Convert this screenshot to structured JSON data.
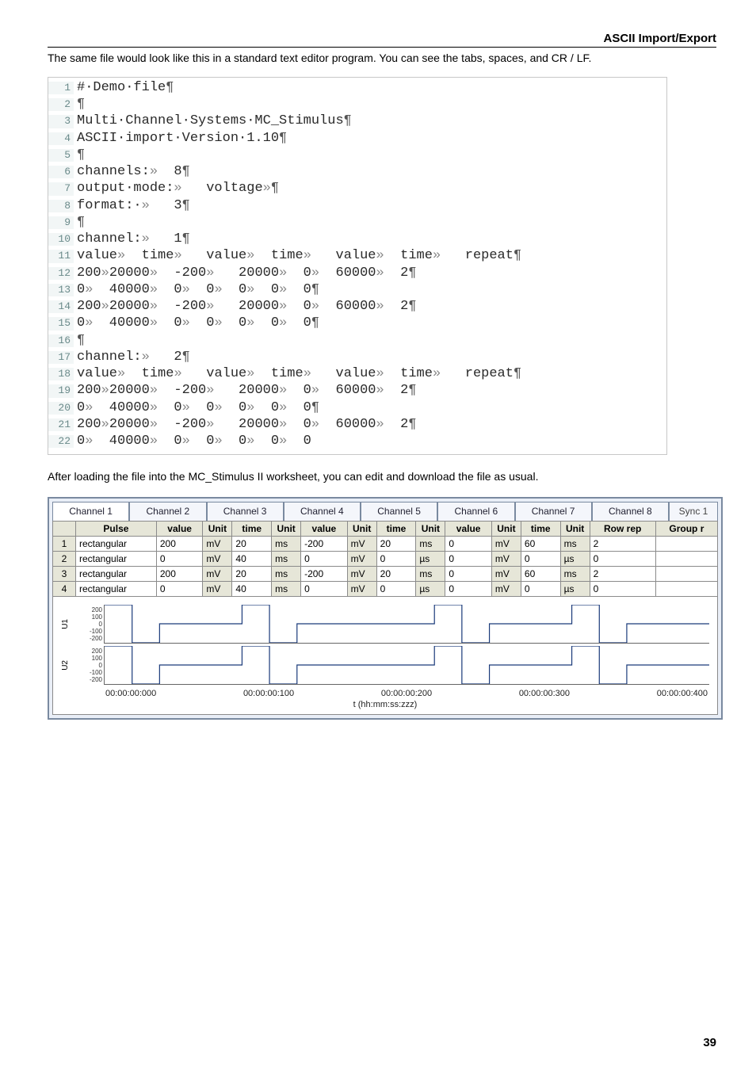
{
  "header": {
    "title": "ASCII Import/Export"
  },
  "intro": "The same file would look like this in a standard text editor program. You can see the tabs, spaces, and CR / LF.",
  "editor": {
    "lines": [
      "#·Demo·file¶",
      "¶",
      "Multi·Channel·Systems·MC_Stimulus¶",
      "ASCII·import·Version·1.10¶",
      "¶",
      "channels:»  8¶",
      "output·mode:»   voltage»¶",
      "format:·»   3¶",
      "¶",
      "channel:»   1¶",
      "value»  time»   value»  time»   value»  time»   repeat¶",
      "200»20000»  -200»   20000»  0»  60000»  2¶",
      "0»  40000»  0»  0»  0»  0»  0¶",
      "200»20000»  -200»   20000»  0»  60000»  2¶",
      "0»  40000»  0»  0»  0»  0»  0¶",
      "¶",
      "channel:»   2¶",
      "value»  time»   value»  time»   value»  time»   repeat¶",
      "200»20000»  -200»   20000»  0»  60000»  2¶",
      "0»  40000»  0»  0»  0»  0»  0¶",
      "200»20000»  -200»   20000»  0»  60000»  2¶",
      "0»  40000»  0»  0»  0»  0»  0"
    ]
  },
  "after_editor": "After loading the file into the MC_Stimulus II worksheet, you can edit and download the file as usual.",
  "worksheet": {
    "tabs": [
      "Channel 1",
      "Channel 2",
      "Channel 3",
      "Channel 4",
      "Channel 5",
      "Channel 6",
      "Channel 7",
      "Channel 8"
    ],
    "sync_tab": "Sync 1",
    "columns": [
      "",
      "Pulse",
      "value",
      "Unit",
      "time",
      "Unit",
      "value",
      "Unit",
      "time",
      "Unit",
      "value",
      "Unit",
      "time",
      "Unit",
      "Row rep",
      "Group r"
    ],
    "rows": [
      {
        "n": "1",
        "pulse": "rectangular",
        "v1": "200",
        "u1": "mV",
        "t1": "20",
        "tu1": "ms",
        "v2": "-200",
        "u2": "mV",
        "t2": "20",
        "tu2": "ms",
        "v3": "0",
        "u3": "mV",
        "t3": "60",
        "tu3": "ms",
        "rr": "2",
        "gr": ""
      },
      {
        "n": "2",
        "pulse": "rectangular",
        "v1": "0",
        "u1": "mV",
        "t1": "40",
        "tu1": "ms",
        "v2": "0",
        "u2": "mV",
        "t2": "0",
        "tu2": "µs",
        "v3": "0",
        "u3": "mV",
        "t3": "0",
        "tu3": "µs",
        "rr": "0",
        "gr": ""
      },
      {
        "n": "3",
        "pulse": "rectangular",
        "v1": "200",
        "u1": "mV",
        "t1": "20",
        "tu1": "ms",
        "v2": "-200",
        "u2": "mV",
        "t2": "20",
        "tu2": "ms",
        "v3": "0",
        "u3": "mV",
        "t3": "60",
        "tu3": "ms",
        "rr": "2",
        "gr": ""
      },
      {
        "n": "4",
        "pulse": "rectangular",
        "v1": "0",
        "u1": "mV",
        "t1": "40",
        "tu1": "ms",
        "v2": "0",
        "u2": "mV",
        "t2": "0",
        "tu2": "µs",
        "v3": "0",
        "u3": "mV",
        "t3": "0",
        "tu3": "µs",
        "rr": "0",
        "gr": ""
      }
    ],
    "plot": {
      "y_ticks": [
        "200",
        "100",
        "0",
        "-100",
        "-200"
      ],
      "series_labels": [
        "U1",
        "U2"
      ],
      "x_ticks": [
        "00:00:00:000",
        "00:00:00:100",
        "00:00:00:200",
        "00:00:00:300",
        "00:00:00:400"
      ],
      "x_caption": "t (hh:mm:ss:zzz)"
    }
  },
  "page_number": "39",
  "chart_data": {
    "type": "line",
    "title": "",
    "xlabel": "t (hh:mm:ss:zzz)",
    "ylabel": "mV",
    "ylim": [
      -200,
      200
    ],
    "x": [
      0,
      20,
      20,
      40,
      40,
      100,
      100,
      120,
      120,
      140,
      140,
      200,
      200,
      240,
      240,
      260,
      260,
      280,
      280,
      340,
      340,
      360,
      360,
      380,
      380,
      440
    ],
    "series": [
      {
        "name": "U1",
        "values": [
          200,
          200,
          -200,
          -200,
          0,
          0,
          200,
          200,
          -200,
          -200,
          0,
          0,
          0,
          0,
          200,
          200,
          -200,
          -200,
          0,
          0,
          200,
          200,
          -200,
          -200,
          0,
          0
        ]
      },
      {
        "name": "U2",
        "values": [
          200,
          200,
          -200,
          -200,
          0,
          0,
          200,
          200,
          -200,
          -200,
          0,
          0,
          0,
          0,
          200,
          200,
          -200,
          -200,
          0,
          0,
          200,
          200,
          -200,
          -200,
          0,
          0
        ]
      }
    ],
    "x_unit": "ms"
  }
}
